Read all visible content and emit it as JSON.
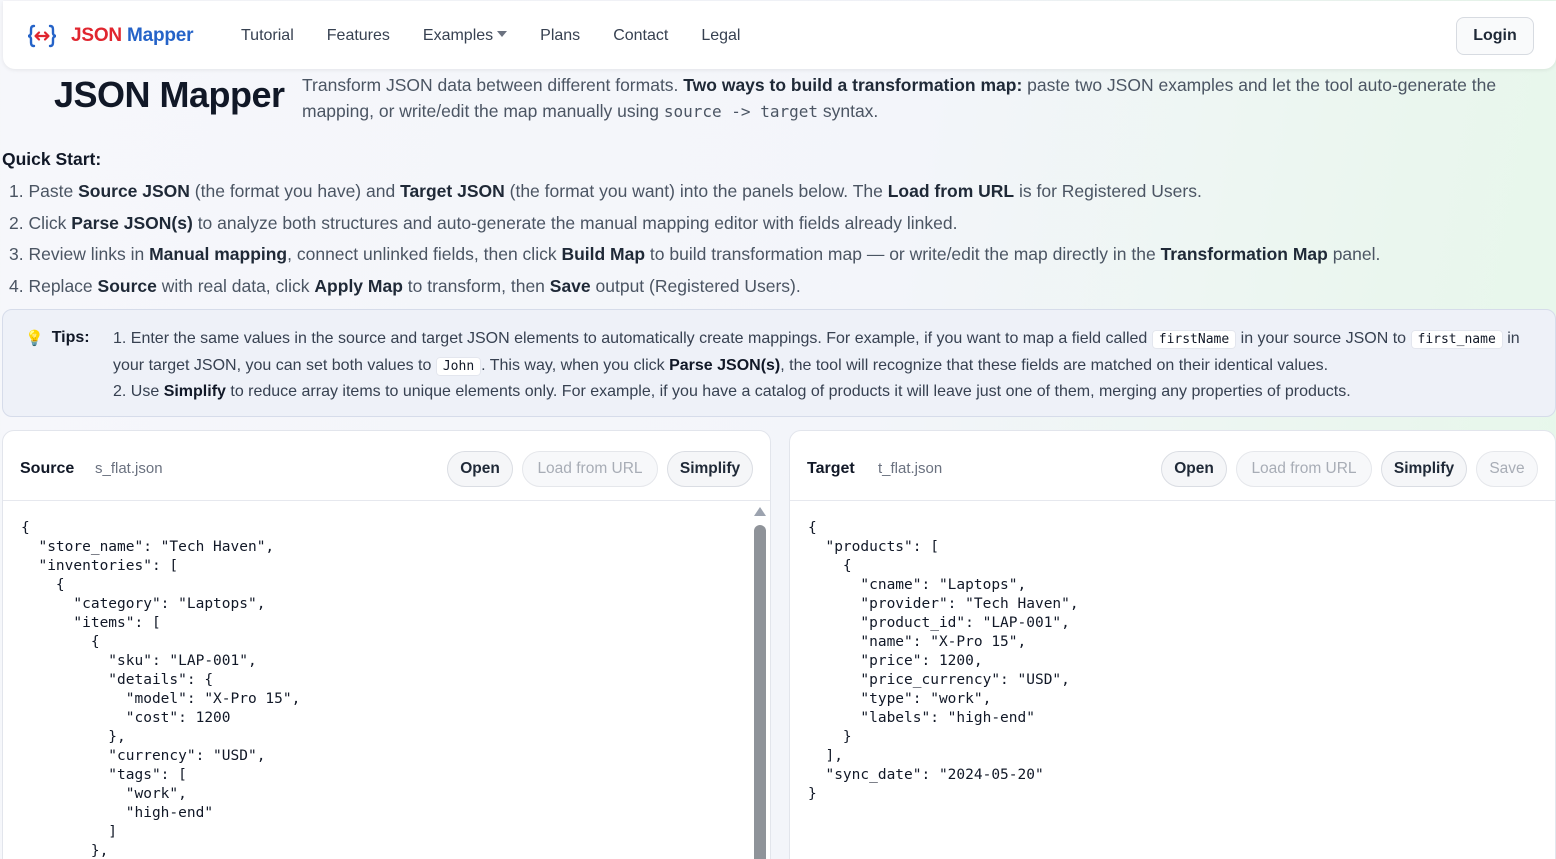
{
  "brand": {
    "json": "JSON",
    "mapper": "Mapper"
  },
  "nav": {
    "items": [
      "Tutorial",
      "Features",
      "Examples",
      "Plans",
      "Contact",
      "Legal"
    ],
    "login": "Login"
  },
  "hero": {
    "title": "JSON Mapper",
    "desc_1": "Transform JSON data between different formats. ",
    "desc_bold": "Two ways to build a transformation map:",
    "desc_2": " paste two JSON examples and let the tool auto-generate the mapping, or write/edit the map manually using ",
    "desc_code": "source -> target",
    "desc_3": " syntax."
  },
  "quick_start": {
    "title": "Quick Start:",
    "s1": [
      "1. Paste ",
      "Source JSON",
      " (the format you have) and ",
      "Target JSON",
      " (the format you want) into the panels below. The ",
      "Load from URL",
      " is for Registered Users."
    ],
    "s2": [
      "2. Click ",
      "Parse JSON(s)",
      " to analyze both structures and auto-generate the manual mapping editor with fields already linked."
    ],
    "s3": [
      "3. Review links in ",
      "Manual mapping",
      ", connect unlinked fields, then click ",
      "Build Map",
      " to build transformation map — or write/edit the map directly in the ",
      "Transformation Map",
      " panel."
    ],
    "s4": [
      "4. Replace ",
      "Source",
      " with real data, click ",
      "Apply Map",
      " to transform, then ",
      "Save",
      " output (Registered Users)."
    ]
  },
  "tips": {
    "label": "Tips:",
    "t1": [
      "1. Enter the same values in the source and target JSON elements to automatically create mappings. For example, if you want to map a field called ",
      "firstName",
      " in your source JSON to ",
      "first_name",
      " in your target JSON, you can set both values to ",
      "John",
      ". This way, when you click ",
      "Parse JSON(s)",
      ", the tool will recognize that these fields are matched on their identical values."
    ],
    "t2": [
      "2. Use ",
      "Simplify",
      " to reduce array items to unique elements only. For example, if you have a catalog of products it will leave just one of them, merging any properties of products."
    ]
  },
  "source": {
    "title": "Source",
    "file": "s_flat.json",
    "buttons": {
      "open": "Open",
      "load_url": "Load from URL",
      "simplify": "Simplify"
    },
    "code": "{\n  \"store_name\": \"Tech Haven\",\n  \"inventories\": [\n    {\n      \"category\": \"Laptops\",\n      \"items\": [\n        {\n          \"sku\": \"LAP-001\",\n          \"details\": {\n            \"model\": \"X-Pro 15\",\n            \"cost\": 1200\n          },\n          \"currency\": \"USD\",\n          \"tags\": [\n            \"work\",\n            \"high-end\"\n          ]\n        },"
  },
  "target": {
    "title": "Target",
    "file": "t_flat.json",
    "buttons": {
      "open": "Open",
      "load_url": "Load from URL",
      "simplify": "Simplify",
      "save": "Save"
    },
    "code": "{\n  \"products\": [\n    {\n      \"cname\": \"Laptops\",\n      \"provider\": \"Tech Haven\",\n      \"product_id\": \"LAP-001\",\n      \"name\": \"X-Pro 15\",\n      \"price\": 1200,\n      \"price_currency\": \"USD\",\n      \"type\": \"work\",\n      \"labels\": \"high-end\"\n    }\n  ],\n  \"sync_date\": \"2024-05-20\"\n}"
  },
  "colors": {
    "brand_red": "#e0262f",
    "brand_blue": "#2563c8",
    "bulb": "#f2b60d"
  },
  "icons": {
    "logo": "json-brackets-arrows-icon",
    "tips": "lightbulb-icon",
    "examples": "caret-down-icon",
    "scroll_up": "scroll-up-arrow-icon"
  }
}
